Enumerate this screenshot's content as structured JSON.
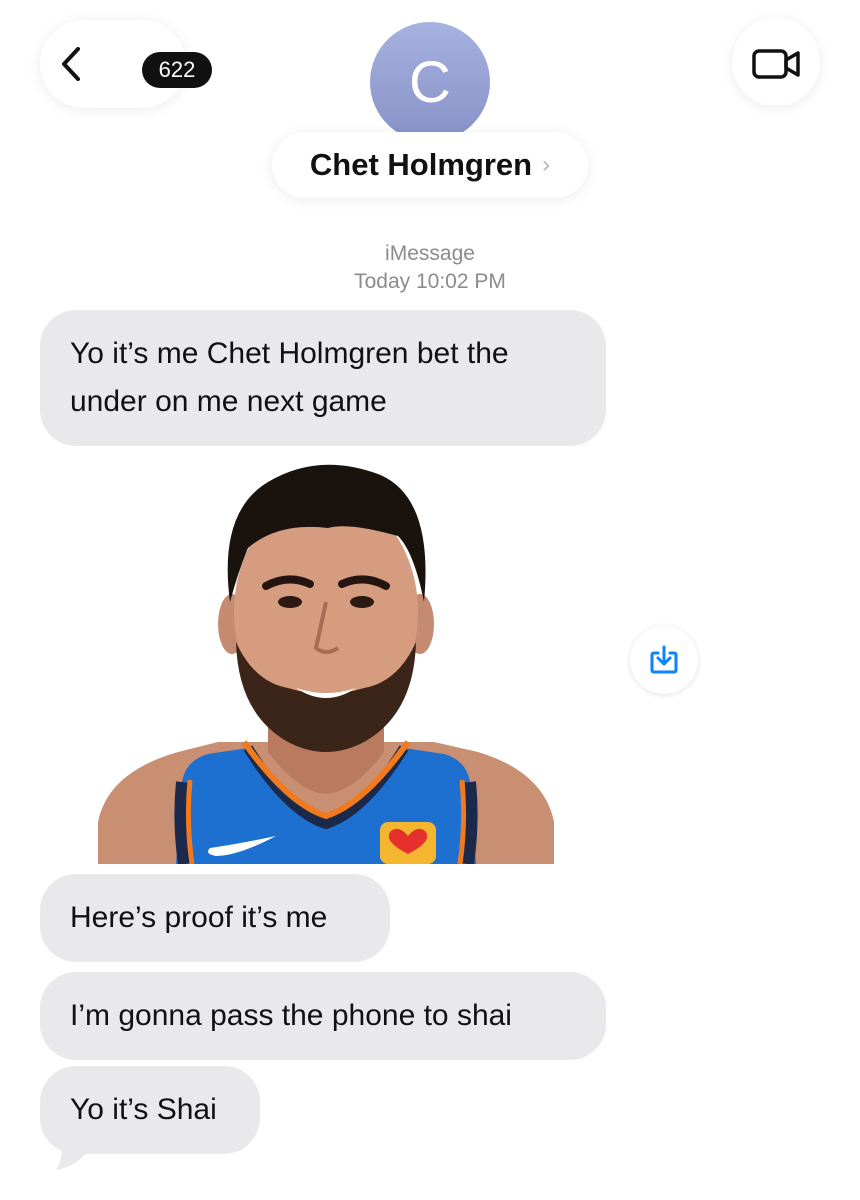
{
  "header": {
    "back_count": "622",
    "avatar_initial": "C",
    "contact_name": "Chet Holmgren"
  },
  "thread": {
    "service": "iMessage",
    "timestamp": "Today 10:02 PM"
  },
  "messages": [
    {
      "line1": "Yo it’s me Chet Holmgren bet the",
      "line2": "under on me next game"
    },
    {
      "text": "Here’s proof it’s me"
    },
    {
      "text": "I’m gonna pass the phone to shai"
    },
    {
      "text": "Yo it’s Shai"
    }
  ],
  "colors": {
    "bubble": "#e9e9eb",
    "accent": "#0a84ff",
    "jersey_blue": "#1d6fd0",
    "jersey_orange": "#f07a1d"
  },
  "icons": [
    "chevron-left-icon",
    "video-camera-icon",
    "chevron-right-icon",
    "save-download-icon"
  ]
}
